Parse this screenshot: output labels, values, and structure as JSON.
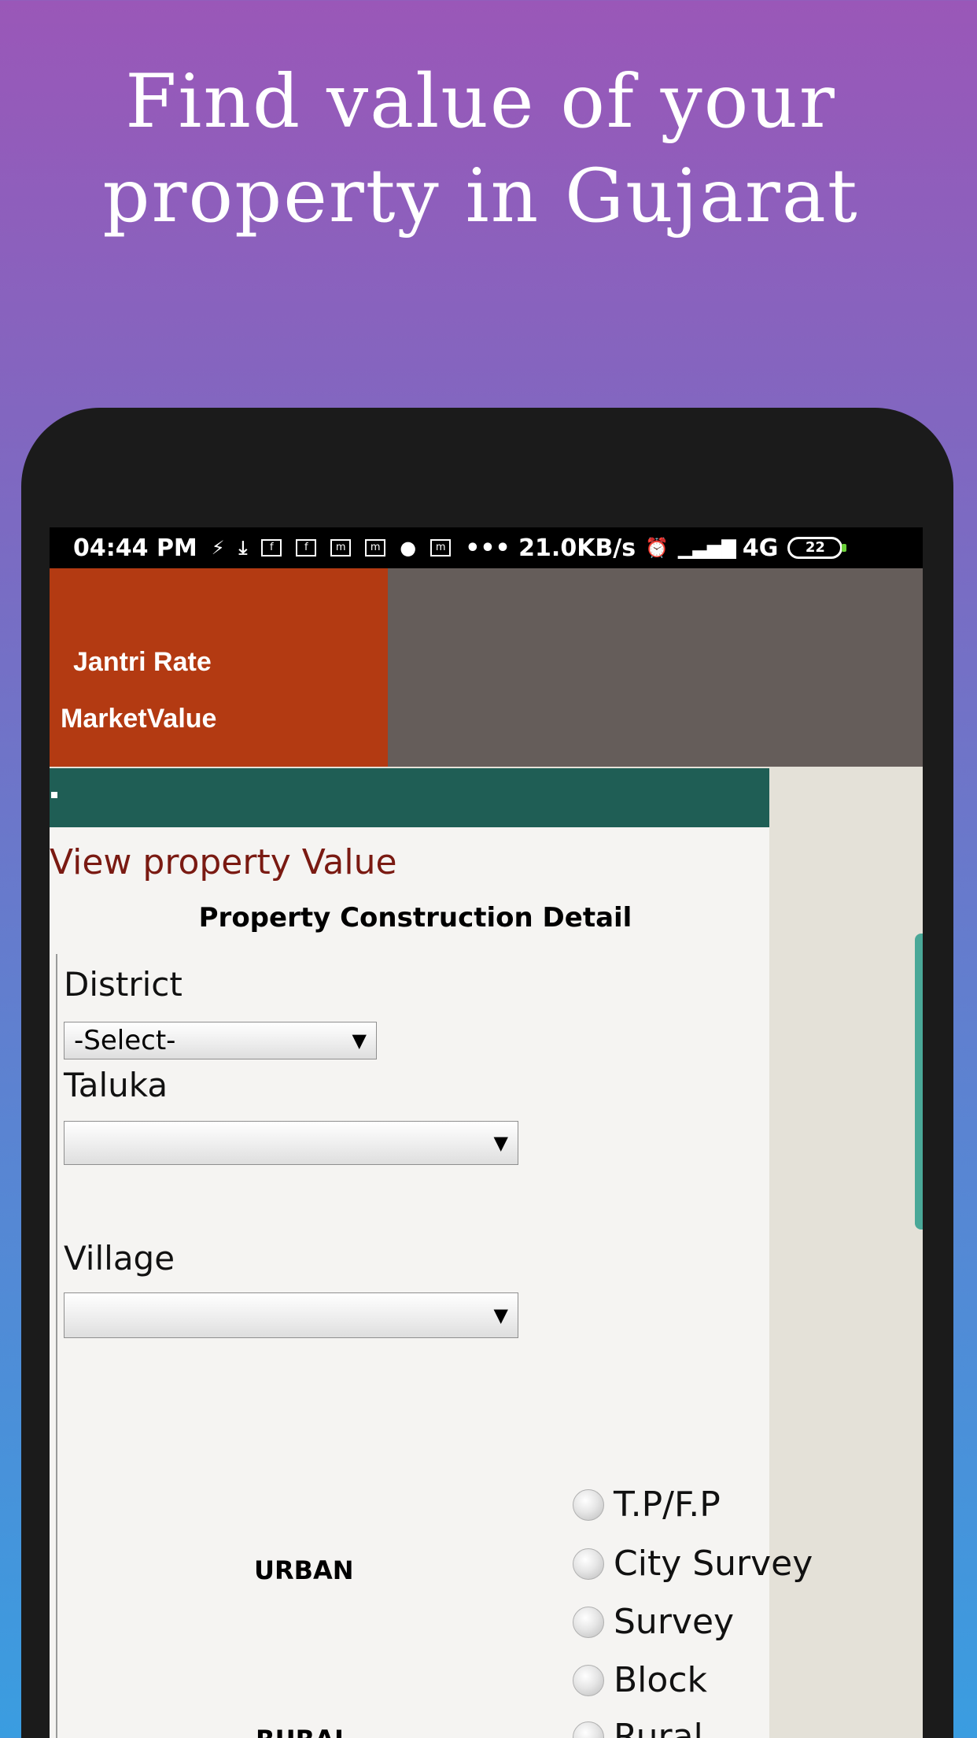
{
  "promo": {
    "headline_line1": "Find value of your",
    "headline_line2": "property in Gujarat"
  },
  "status_bar": {
    "time": "04:44 PM",
    "speed": "••• 21.0KB/s",
    "network": "4G",
    "battery": "22"
  },
  "app_bar": {
    "title_line1": "Jantri Rate",
    "title_line2": "MarketValue"
  },
  "page": {
    "view_title": "View property Value",
    "section_title": "Property Construction Detail"
  },
  "form": {
    "district_label": "District",
    "district_value": "-Select-",
    "taluka_label": "Taluka",
    "taluka_value": "",
    "village_label": "Village",
    "village_value": ""
  },
  "area_type": {
    "urban_label": "URBAN",
    "rural_label": "RURAL",
    "options": [
      "T.P/F.P",
      "City Survey",
      "Survey",
      "Block",
      "Rural"
    ]
  },
  "colors": {
    "appbar_accent": "#b33a12",
    "toolbar": "#1f5e55",
    "title_text": "#7a1a12"
  }
}
